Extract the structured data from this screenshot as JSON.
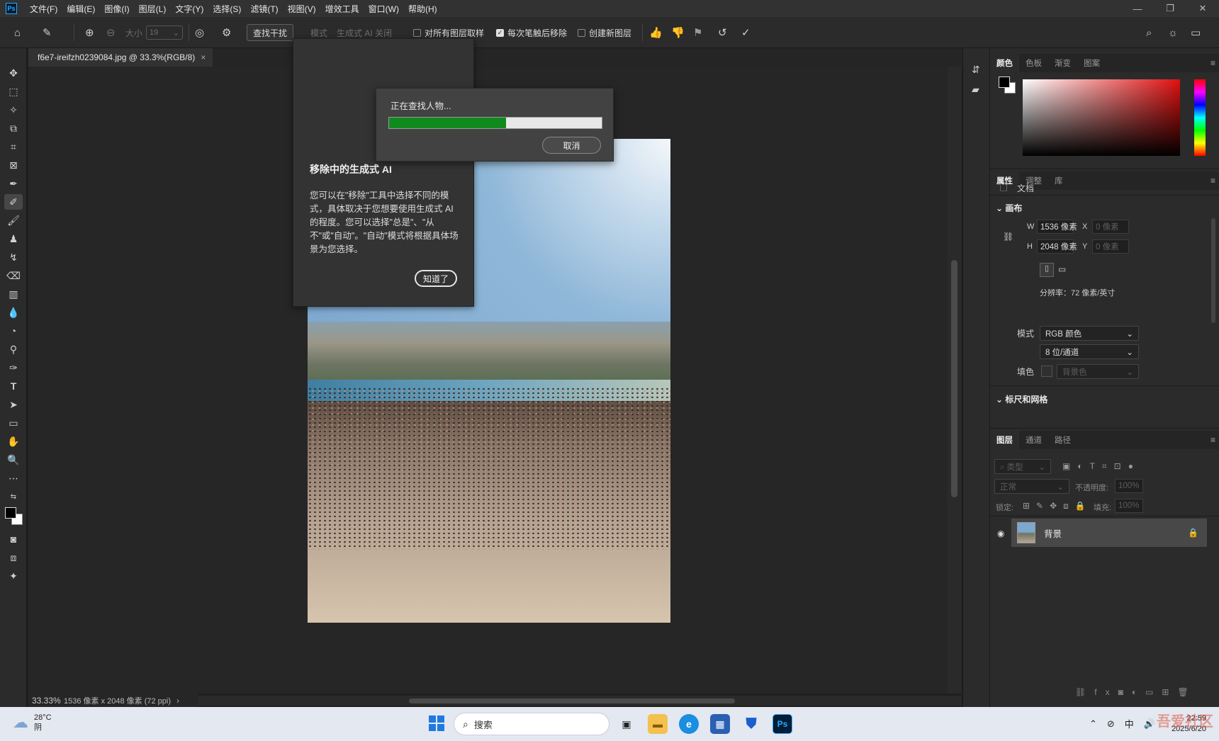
{
  "app": {
    "logo": "Ps",
    "menu": [
      "文件(F)",
      "编辑(E)",
      "图像(I)",
      "图层(L)",
      "文字(Y)",
      "选择(S)",
      "滤镜(T)",
      "视图(V)",
      "增效工具",
      "窗口(W)",
      "帮助(H)"
    ],
    "window_controls": [
      "—",
      "❐",
      "✕"
    ]
  },
  "options": {
    "size_label": "大小",
    "size_value": "19",
    "find_distractions": "查找干扰",
    "mode_label": "模式",
    "mode_value": "生成式 AI 关闭",
    "sample_all_layers": "对所有图层取样",
    "remove_after_stroke": "每次笔触后移除",
    "create_new_layer": "创建新图层"
  },
  "document": {
    "tab_title": "f6e7-ireifzh0239084.jpg @ 33.3%(RGB/8)",
    "tab_close": "×",
    "zoom": "33.33%",
    "dimensions": "1536 像素 x 2048 像素 (72 ppi)",
    "status_arrow": "›"
  },
  "tooltip": {
    "title": "移除中的生成式 AI",
    "body": "您可以在\"移除\"工具中选择不同的模式，具体取决于您想要使用生成式 AI 的程度。您可以选择\"总是\"、\"从不\"或\"自动\"。\"自动\"模式将根据具体场景为您选择。",
    "button": "知道了"
  },
  "progress": {
    "message": "正在查找人物...",
    "percent": 55,
    "cancel": "取消"
  },
  "color_panel": {
    "tabs": [
      "颜色",
      "色板",
      "渐变",
      "图案"
    ]
  },
  "properties_panel": {
    "tabs": [
      "属性",
      "调整",
      "库"
    ],
    "doc_label": "文档",
    "canvas_section": "画布",
    "w_label": "W",
    "w_value": "1536 像素",
    "h_label": "H",
    "h_value": "2048 像素",
    "x_label": "X",
    "x_placeholder": "0 像素",
    "y_label": "Y",
    "y_placeholder": "0 像素",
    "resolution": "分辨率：72 像素/英寸",
    "mode_label": "模式",
    "mode_value": "RGB 颜色",
    "depth_value": "8 位/通道",
    "fill_label": "填色",
    "fill_value": "背景色",
    "rulers_section": "标尺和网格"
  },
  "layers_panel": {
    "tabs": [
      "图层",
      "通道",
      "路径"
    ],
    "filter_placeholder": "类型",
    "blend_mode": "正常",
    "opacity_label": "不透明度:",
    "opacity_value": "100%",
    "lock_label": "锁定:",
    "fill_label": "填充:",
    "fill_value": "100%",
    "layer_name": "背景"
  },
  "taskbar": {
    "temperature": "28°C",
    "weather": "阴",
    "search": "搜索",
    "ime": "中",
    "time": "22:59",
    "date": "2025/6/20",
    "watermark": "吾爱社区"
  }
}
